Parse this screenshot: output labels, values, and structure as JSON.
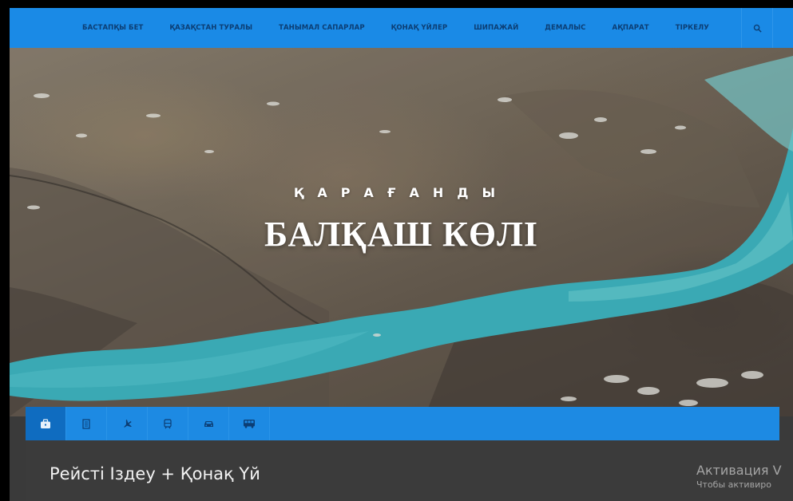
{
  "nav": {
    "items": [
      {
        "label": "БАСТАПҚЫ БЕТ"
      },
      {
        "label": "ҚАЗАҚСТАН ТУРАЛЫ"
      },
      {
        "label": "ТАНЫМАЛ САПАРЛАР"
      },
      {
        "label": "ҚОНАҚ ҮЙЛЕР"
      },
      {
        "label": "ШИПАЖАЙ"
      },
      {
        "label": "ДЕМАЛЫС"
      },
      {
        "label": "АҚПАРАТ"
      },
      {
        "label": "ТІРКЕЛУ"
      }
    ],
    "search_icon": "search-icon"
  },
  "hero": {
    "subtitle": "ҚАРАҒАНДЫ",
    "title": "БАЛҚАШ КӨЛІ"
  },
  "tabs": [
    {
      "icon": "suitcase-icon",
      "active": true
    },
    {
      "icon": "hotel-icon",
      "active": false
    },
    {
      "icon": "airplane-icon",
      "active": false
    },
    {
      "icon": "train-icon",
      "active": false
    },
    {
      "icon": "car-icon",
      "active": false
    },
    {
      "icon": "bus-icon",
      "active": false
    }
  ],
  "panel": {
    "title": "Рейсті Іздеу + Қонақ Үй"
  },
  "watermark": {
    "line1": "Активация V",
    "line2": "Чтобы активиро"
  },
  "colors": {
    "nav_bg": "#1a8ae6",
    "nav_text": "#0c3e74",
    "tab_bg": "#1d8ae3",
    "tab_active": "#0f6cc0",
    "panel_bg": "#3b3b3b",
    "lake": "#3fb8c4"
  }
}
